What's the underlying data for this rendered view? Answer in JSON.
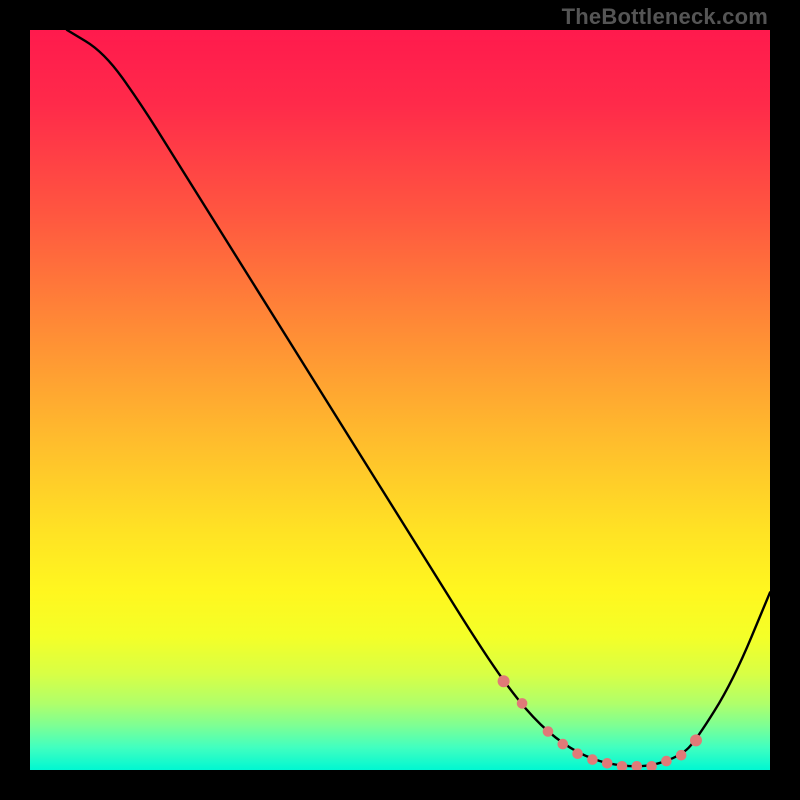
{
  "attribution": "TheBottleneck.com",
  "chart_data": {
    "type": "line",
    "title": "",
    "xlabel": "",
    "ylabel": "",
    "xlim": [
      0,
      100
    ],
    "ylim": [
      0,
      100
    ],
    "grid": false,
    "series": [
      {
        "name": "curve",
        "x": [
          5,
          10,
          15,
          20,
          30,
          40,
          50,
          55,
          60,
          64,
          68,
          72,
          76,
          80,
          84,
          88,
          90,
          95,
          100
        ],
        "y": [
          100,
          97,
          90,
          82,
          66,
          50,
          34,
          26,
          18,
          12,
          7,
          3.5,
          1.4,
          0.5,
          0.5,
          2,
          4,
          12,
          24
        ]
      }
    ],
    "markers": {
      "name": "highlight-dots",
      "color": "#e07a78",
      "x": [
        64,
        66.5,
        70,
        72,
        74,
        76,
        78,
        80,
        82,
        84,
        86,
        88,
        90
      ],
      "y": [
        12,
        9,
        5.2,
        3.5,
        2.2,
        1.4,
        0.9,
        0.5,
        0.5,
        0.5,
        1.2,
        2,
        4
      ]
    }
  },
  "colors": {
    "curve": "#000000",
    "markers": "#e07a78",
    "frame": "#000000"
  }
}
